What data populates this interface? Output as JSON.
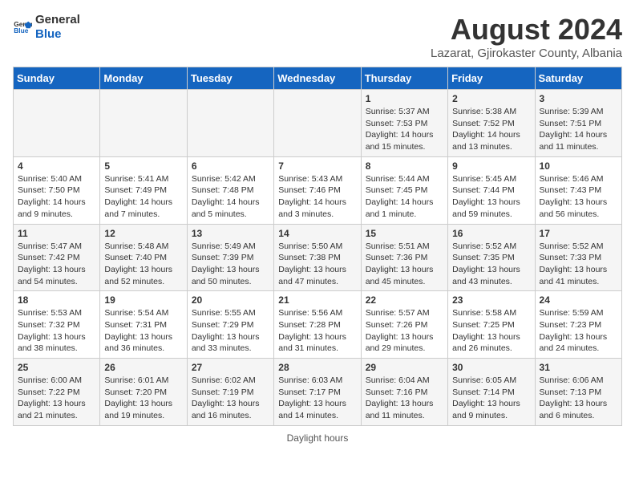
{
  "header": {
    "logo_general": "General",
    "logo_blue": "Blue",
    "title": "August 2024",
    "subtitle": "Lazarat, Gjirokaster County, Albania"
  },
  "calendar": {
    "days_of_week": [
      "Sunday",
      "Monday",
      "Tuesday",
      "Wednesday",
      "Thursday",
      "Friday",
      "Saturday"
    ],
    "weeks": [
      [
        {
          "day": "",
          "info": ""
        },
        {
          "day": "",
          "info": ""
        },
        {
          "day": "",
          "info": ""
        },
        {
          "day": "",
          "info": ""
        },
        {
          "day": "1",
          "info": "Sunrise: 5:37 AM\nSunset: 7:53 PM\nDaylight: 14 hours and 15 minutes."
        },
        {
          "day": "2",
          "info": "Sunrise: 5:38 AM\nSunset: 7:52 PM\nDaylight: 14 hours and 13 minutes."
        },
        {
          "day": "3",
          "info": "Sunrise: 5:39 AM\nSunset: 7:51 PM\nDaylight: 14 hours and 11 minutes."
        }
      ],
      [
        {
          "day": "4",
          "info": "Sunrise: 5:40 AM\nSunset: 7:50 PM\nDaylight: 14 hours and 9 minutes."
        },
        {
          "day": "5",
          "info": "Sunrise: 5:41 AM\nSunset: 7:49 PM\nDaylight: 14 hours and 7 minutes."
        },
        {
          "day": "6",
          "info": "Sunrise: 5:42 AM\nSunset: 7:48 PM\nDaylight: 14 hours and 5 minutes."
        },
        {
          "day": "7",
          "info": "Sunrise: 5:43 AM\nSunset: 7:46 PM\nDaylight: 14 hours and 3 minutes."
        },
        {
          "day": "8",
          "info": "Sunrise: 5:44 AM\nSunset: 7:45 PM\nDaylight: 14 hours and 1 minute."
        },
        {
          "day": "9",
          "info": "Sunrise: 5:45 AM\nSunset: 7:44 PM\nDaylight: 13 hours and 59 minutes."
        },
        {
          "day": "10",
          "info": "Sunrise: 5:46 AM\nSunset: 7:43 PM\nDaylight: 13 hours and 56 minutes."
        }
      ],
      [
        {
          "day": "11",
          "info": "Sunrise: 5:47 AM\nSunset: 7:42 PM\nDaylight: 13 hours and 54 minutes."
        },
        {
          "day": "12",
          "info": "Sunrise: 5:48 AM\nSunset: 7:40 PM\nDaylight: 13 hours and 52 minutes."
        },
        {
          "day": "13",
          "info": "Sunrise: 5:49 AM\nSunset: 7:39 PM\nDaylight: 13 hours and 50 minutes."
        },
        {
          "day": "14",
          "info": "Sunrise: 5:50 AM\nSunset: 7:38 PM\nDaylight: 13 hours and 47 minutes."
        },
        {
          "day": "15",
          "info": "Sunrise: 5:51 AM\nSunset: 7:36 PM\nDaylight: 13 hours and 45 minutes."
        },
        {
          "day": "16",
          "info": "Sunrise: 5:52 AM\nSunset: 7:35 PM\nDaylight: 13 hours and 43 minutes."
        },
        {
          "day": "17",
          "info": "Sunrise: 5:52 AM\nSunset: 7:33 PM\nDaylight: 13 hours and 41 minutes."
        }
      ],
      [
        {
          "day": "18",
          "info": "Sunrise: 5:53 AM\nSunset: 7:32 PM\nDaylight: 13 hours and 38 minutes."
        },
        {
          "day": "19",
          "info": "Sunrise: 5:54 AM\nSunset: 7:31 PM\nDaylight: 13 hours and 36 minutes."
        },
        {
          "day": "20",
          "info": "Sunrise: 5:55 AM\nSunset: 7:29 PM\nDaylight: 13 hours and 33 minutes."
        },
        {
          "day": "21",
          "info": "Sunrise: 5:56 AM\nSunset: 7:28 PM\nDaylight: 13 hours and 31 minutes."
        },
        {
          "day": "22",
          "info": "Sunrise: 5:57 AM\nSunset: 7:26 PM\nDaylight: 13 hours and 29 minutes."
        },
        {
          "day": "23",
          "info": "Sunrise: 5:58 AM\nSunset: 7:25 PM\nDaylight: 13 hours and 26 minutes."
        },
        {
          "day": "24",
          "info": "Sunrise: 5:59 AM\nSunset: 7:23 PM\nDaylight: 13 hours and 24 minutes."
        }
      ],
      [
        {
          "day": "25",
          "info": "Sunrise: 6:00 AM\nSunset: 7:22 PM\nDaylight: 13 hours and 21 minutes."
        },
        {
          "day": "26",
          "info": "Sunrise: 6:01 AM\nSunset: 7:20 PM\nDaylight: 13 hours and 19 minutes."
        },
        {
          "day": "27",
          "info": "Sunrise: 6:02 AM\nSunset: 7:19 PM\nDaylight: 13 hours and 16 minutes."
        },
        {
          "day": "28",
          "info": "Sunrise: 6:03 AM\nSunset: 7:17 PM\nDaylight: 13 hours and 14 minutes."
        },
        {
          "day": "29",
          "info": "Sunrise: 6:04 AM\nSunset: 7:16 PM\nDaylight: 13 hours and 11 minutes."
        },
        {
          "day": "30",
          "info": "Sunrise: 6:05 AM\nSunset: 7:14 PM\nDaylight: 13 hours and 9 minutes."
        },
        {
          "day": "31",
          "info": "Sunrise: 6:06 AM\nSunset: 7:13 PM\nDaylight: 13 hours and 6 minutes."
        }
      ]
    ]
  },
  "footer": {
    "note": "Daylight hours"
  }
}
